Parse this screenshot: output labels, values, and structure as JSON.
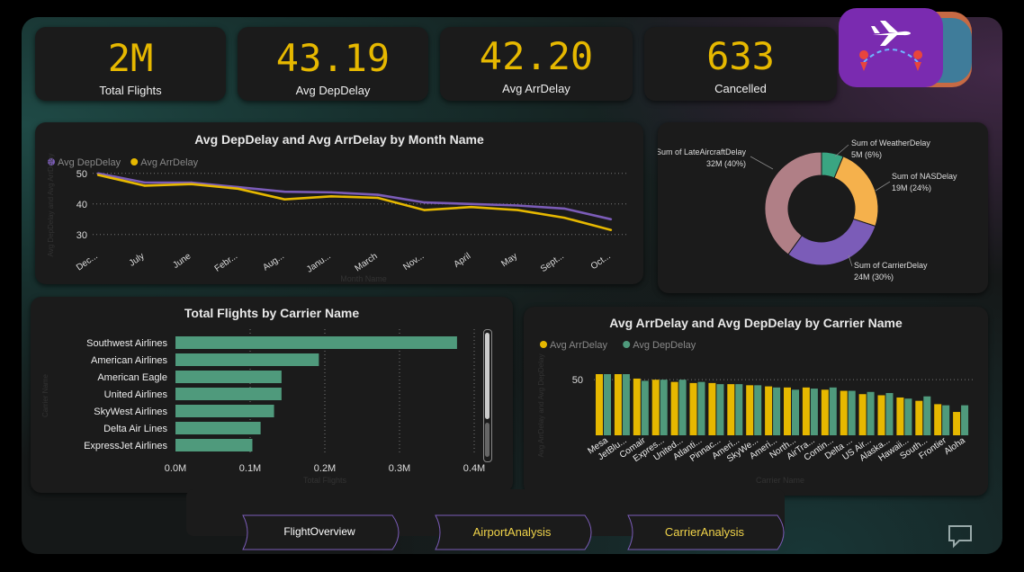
{
  "kpis": [
    {
      "value": "2M",
      "label": "Total Flights"
    },
    {
      "value": "43.19",
      "label": "Avg DepDelay"
    },
    {
      "value": "42.20",
      "label": "Avg ArrDelay"
    },
    {
      "value": "633",
      "label": "Cancelled"
    }
  ],
  "nav": {
    "overview": "FlightOverview",
    "airport": "AirportAnalysis",
    "carrier": "CarrierAnalysis"
  },
  "colors": {
    "accent": "#e6b800",
    "purple": "#7b5cb8",
    "teal": "#4f9a7c",
    "pink": "#b07f86",
    "orange": "#f5b14c",
    "green": "#3aa582"
  },
  "icons": {
    "logo": "airplane-route-icon",
    "comment": "comment-icon"
  },
  "chart_data": [
    {
      "type": "line",
      "title": "Avg DepDelay and Avg ArrDelay by Month Name",
      "xlabel": "Month Name",
      "ylabel": "Avg DepDelay and Avg ArrDelay",
      "categories": [
        "Dec...",
        "July",
        "June",
        "Febr...",
        "Aug...",
        "Janu...",
        "March",
        "Nov...",
        "April",
        "May",
        "Sept...",
        "Oct..."
      ],
      "series": [
        {
          "name": "Avg DepDelay",
          "color": "#7b5cb8",
          "values": [
            50,
            47,
            47,
            45.5,
            44,
            43.8,
            43,
            40.5,
            40,
            39.5,
            38.5,
            35
          ]
        },
        {
          "name": "Avg ArrDelay",
          "color": "#e6b800",
          "values": [
            49.5,
            46,
            46.5,
            45,
            41.5,
            42.5,
            42,
            38,
            39,
            38,
            35.5,
            31.5
          ]
        }
      ],
      "ylim": [
        27,
        52
      ],
      "yticks": [
        30,
        40,
        50
      ],
      "grid": true,
      "legend": "top-left"
    },
    {
      "type": "pie",
      "categories": [
        "Sum of LateAircraftDelay",
        "Sum of WeatherDelay",
        "Sum of NASDelay",
        "Sum of CarrierDelay"
      ],
      "values": [
        32,
        5,
        19,
        24
      ],
      "labels": [
        "32M (40%)",
        "5M (6%)",
        "19M (24%)",
        "24M (30%)"
      ],
      "colors": [
        "#b07f86",
        "#3aa582",
        "#f5b14c",
        "#7b5cb8"
      ]
    },
    {
      "type": "bar",
      "orientation": "horizontal",
      "title": "Total Flights by Carrier Name",
      "xlabel": "Total Flights",
      "ylabel": "Carrier Name",
      "categories": [
        "Southwest Airlines",
        "American Airlines",
        "American Eagle",
        "United Airlines",
        "SkyWest Airlines",
        "Delta Air Lines",
        "ExpressJet Airlines"
      ],
      "values": [
        0.377,
        0.192,
        0.142,
        0.142,
        0.132,
        0.114,
        0.103
      ],
      "xticks": [
        "0.0M",
        "0.1M",
        "0.2M",
        "0.3M",
        "0.4M"
      ],
      "xlim": [
        0,
        0.4
      ],
      "color": "#4f9a7c"
    },
    {
      "type": "bar",
      "title": "Avg ArrDelay and Avg DepDelay by Carrier Name",
      "xlabel": "Carrier Name",
      "ylabel": "Avg ArrDelay and Avg DepDelay",
      "categories": [
        "Mesa",
        "JetBlu...",
        "Comair",
        "Expres...",
        "United...",
        "Atlanti...",
        "Pinnac...",
        "Ameri...",
        "SkyWe...",
        "Ameri...",
        "North...",
        "AirTra...",
        "Contin...",
        "Delta ...",
        "US Air...",
        "Alaska...",
        "Hawaii...",
        "South...",
        "Frontier",
        "Aloha"
      ],
      "series": [
        {
          "name": "Avg ArrDelay",
          "color": "#e6b800",
          "values": [
            55,
            55,
            51,
            50,
            48,
            47,
            47,
            46,
            45,
            44,
            43,
            43,
            41,
            40,
            37,
            36,
            34,
            31,
            28,
            21
          ]
        },
        {
          "name": "Avg DepDelay",
          "color": "#4f9a7c",
          "values": [
            55,
            55,
            49,
            50,
            50,
            48,
            46,
            46,
            45,
            43,
            41,
            42,
            43,
            40,
            39,
            38,
            33,
            35,
            27,
            27
          ]
        }
      ],
      "ylim": [
        0,
        60
      ],
      "yticks": [
        50
      ],
      "legend": "top-left"
    }
  ]
}
